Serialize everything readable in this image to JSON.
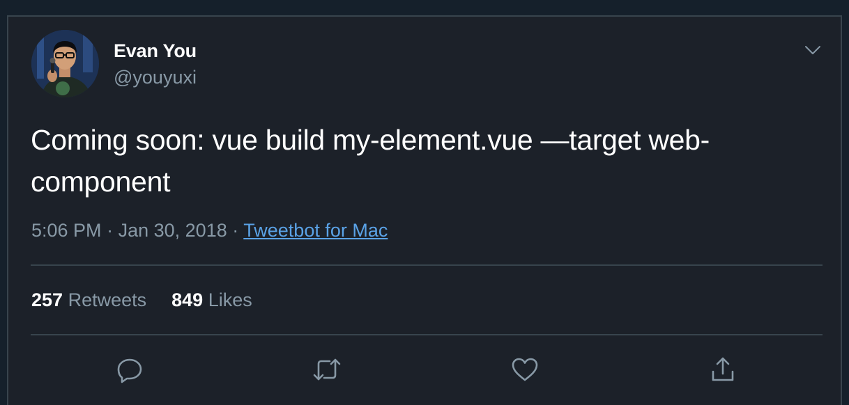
{
  "tweet": {
    "author_name": "Evan You",
    "author_handle": "@youyuxi",
    "text": "Coming soon: vue build my-element.vue —target web-component",
    "time": "5:06 PM",
    "date": "Jan 30, 2018",
    "separator": "·",
    "source": "Tweetbot for Mac"
  },
  "stats": {
    "retweets_count": "257",
    "retweets_label": "Retweets",
    "likes_count": "849",
    "likes_label": "Likes"
  },
  "actions": {
    "reply_icon": "reply-icon",
    "retweet_icon": "retweet-icon",
    "like_icon": "heart-icon",
    "share_icon": "share-icon"
  },
  "colors": {
    "background": "#15202b",
    "card": "#1c2129",
    "secondary_text": "#8899a6",
    "link": "#5aa2e6"
  }
}
